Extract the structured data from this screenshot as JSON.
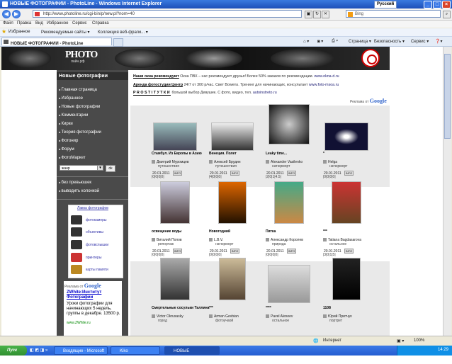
{
  "window": {
    "title": "НОВЫЕ ФОТОГРАФИИ - PhotoLine - Windows Internet Explorer",
    "lang": "Русский"
  },
  "address": {
    "url": "http://www.photoline.ru/cgi-bin/p/new.pl?nom=40",
    "search": "Bing"
  },
  "menu": [
    "Файл",
    "Правка",
    "Вид",
    "Избранное",
    "Сервис",
    "Справка"
  ],
  "favorites": {
    "label": "Избранное",
    "items": [
      "Рекомендуемые сайты ▾",
      "Коллекция веб-фрагм... ▾"
    ]
  },
  "tab": {
    "title": "НОВЫЕ ФОТОГРАФИИ - PhotoLine"
  },
  "commands": [
    "Страница ▾",
    "Безопасность ▾",
    "Сервис ▾"
  ],
  "site": {
    "logo_main": "PHOTO",
    "logo_sub": "лайн.рф",
    "section_title": "Новые фотографии",
    "nav": [
      "Главная страница",
      "Избранное",
      "Новые фотографии",
      "Комментарии",
      "Кирки",
      "Теория фотографии",
      "Фотонир",
      "Форум",
      "ФотоМаркет"
    ],
    "select_value": "жанр",
    "ok_label": "ok",
    "options": [
      "без превьюшек",
      "выводить колонкой"
    ],
    "shop_head": "Лавка фотографов",
    "shop": [
      "фотокамеры",
      "объективы",
      "фотовспышки",
      "принтеры",
      "карты памяти"
    ],
    "ads_label": "Реклама от",
    "ads_google": "Google",
    "ad_title": "ZWhite:Институт Фотографии",
    "ad_body": "Уроки фотографии для начинающих 5 недель, группы в декабре. 13500 р.",
    "ad_url": "www.ZWhite.ru",
    "info1_bold": "Наши окна рекомендуют",
    "info1": " Окна ПВХ – нас рекомендуют друзья! Более 50% заказов по рекомендации. ",
    "info1_link": "www.okna-d.ru",
    "info2_bold": "Аренда фотостудии Центр",
    "info2": " 24/7 от 300 р/час. Свет Bowens. Тренинг для начинающих, консультант ",
    "info2_link": "www.foto-msoa.ru",
    "info3_bold": "PROSTIТУТКИ",
    "info3": " большой выбор Девушек. С фото, видео, тел. ",
    "info3_link": "autoinstreto.ru",
    "google_label": "Реклама от",
    "google": "Google"
  },
  "photos": [
    {
      "title": "Стамбул. Из Европы в Азию",
      "author": "Дмитрий Муромцев",
      "rubric": "путешествия",
      "date": "20.01.2011",
      "badge": "INFO",
      "counts": "|0|0|0|0|"
    },
    {
      "title": "Венеция. Полет",
      "author": "Алексей Брудин",
      "rubric": "путешествия",
      "date": "20.01.2011",
      "badge": "INFO",
      "counts": "|4|0|0|0|"
    },
    {
      "title": "Leaky time...",
      "author": "Alexander Vasilenko",
      "rubric": "натюрморт",
      "date": "20.01.2011",
      "badge": "INFO",
      "counts": "|2|0|1|4.5|"
    },
    {
      "title": "*",
      "author": "Helga",
      "rubric": "натюрморт",
      "date": "20.01.2011",
      "badge": "INFO",
      "counts": "|0|0|0|0|"
    },
    {
      "title": "освещение воды",
      "author": "Виталий Попов",
      "rubric": "репортаж",
      "date": "20.01.2011",
      "badge": "INFO",
      "counts": "|0|0|0|0|"
    },
    {
      "title": "Новогодний",
      "author": "L.B.V.",
      "rubric": "натюрморт",
      "date": "20.01.2011",
      "badge": "INFO",
      "counts": "|0|0|0|0|"
    },
    {
      "title": "Пятка",
      "author": "Александр Королев",
      "rubric": "природа",
      "date": "20.01.2011",
      "badge": "INFO",
      "counts": "|0|0|0|0|"
    },
    {
      "title": "***",
      "author": "Tatiana Bagdasarova",
      "rubric": "остальное",
      "date": "20.01.2011",
      "badge": "INFO",
      "counts": "|3|0|1|5|"
    },
    {
      "title": "Смертельные сосульки Таллина",
      "author": "Victor Okrusasky",
      "rubric": "город",
      "date": "",
      "badge": "",
      "counts": ""
    },
    {
      "title": "***",
      "author": "Arman Gevbian",
      "rubric": "фотоучаой",
      "date": "",
      "badge": "",
      "counts": ""
    },
    {
      "title": "****",
      "author": "Pavel Alexeev",
      "rubric": "остальное",
      "date": "",
      "badge": "",
      "counts": ""
    },
    {
      "title": "1108",
      "author": "Юрий Притчук",
      "rubric": "портрет",
      "date": "",
      "badge": "",
      "counts": ""
    }
  ],
  "status": {
    "zone": "Интернет",
    "zoom": "100%"
  },
  "taskbar": {
    "start": "Пуск",
    "apps": [
      "Входящие - Microsoft O...",
      "Kiko",
      "НОВЫЕ ФОТОГРАФИИ..."
    ],
    "time": "14:29"
  }
}
